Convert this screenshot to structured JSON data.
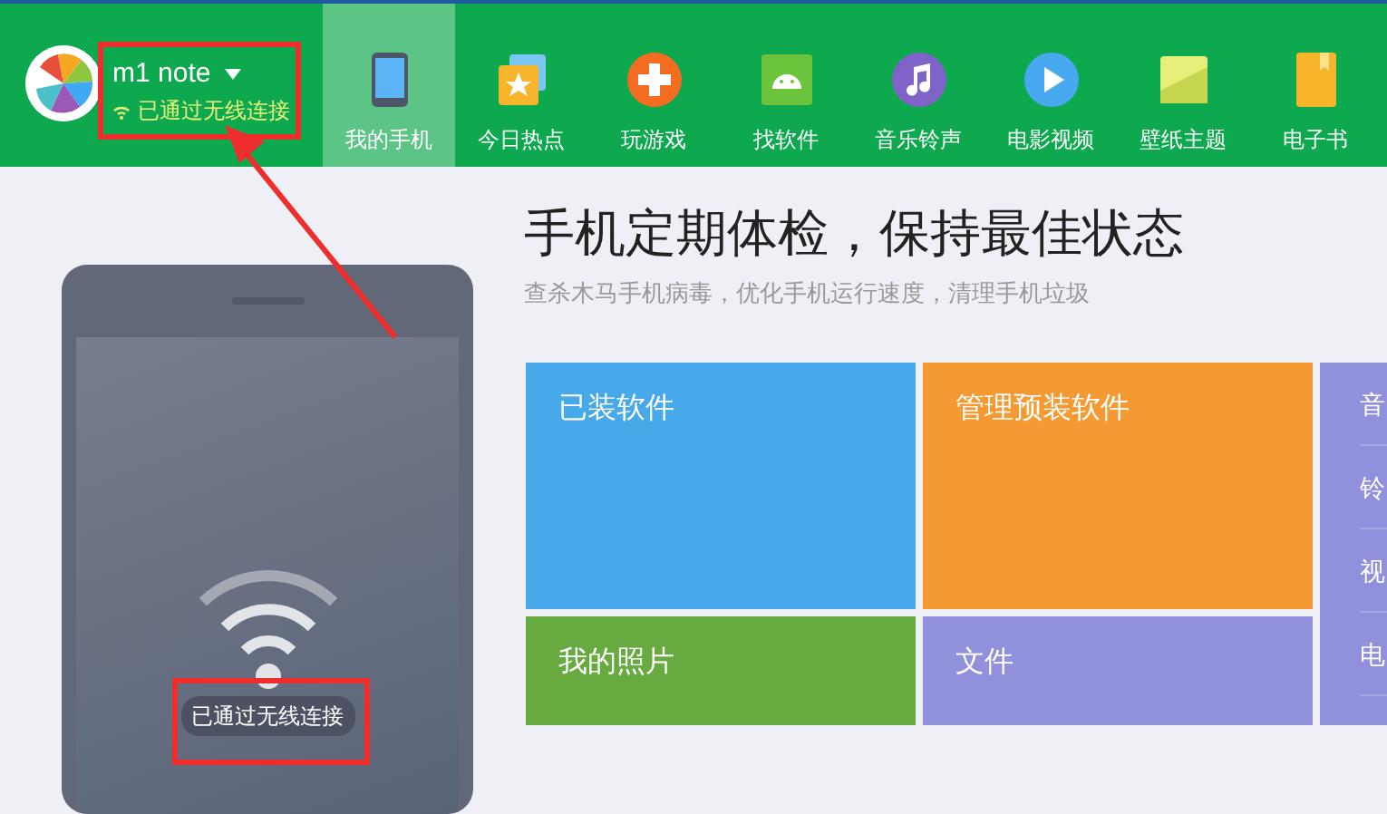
{
  "header": {
    "device_name": "m1 note",
    "connection_status": "已通过无线连接"
  },
  "nav": [
    {
      "label": "我的手机",
      "selected": true
    },
    {
      "label": "今日热点",
      "selected": false
    },
    {
      "label": "玩游戏",
      "selected": false
    },
    {
      "label": "找软件",
      "selected": false
    },
    {
      "label": "音乐铃声",
      "selected": false
    },
    {
      "label": "电影视频",
      "selected": false
    },
    {
      "label": "壁纸主题",
      "selected": false
    },
    {
      "label": "电子书",
      "selected": false
    }
  ],
  "phone": {
    "status": "已通过无线连接"
  },
  "intro": {
    "title": "手机定期体检，保持最佳状态",
    "subtitle": "查杀木马手机病毒，优化手机运行速度，清理手机垃圾"
  },
  "tiles": [
    {
      "label": "已装软件",
      "color": "#47a9ea"
    },
    {
      "label": "管理预装软件",
      "color": "#f59a33"
    },
    {
      "label": "我的照片",
      "color": "#66aa40"
    },
    {
      "label": "文件",
      "color": "#9190dd"
    }
  ],
  "side_list": [
    "音",
    "铃",
    "视",
    "电"
  ]
}
